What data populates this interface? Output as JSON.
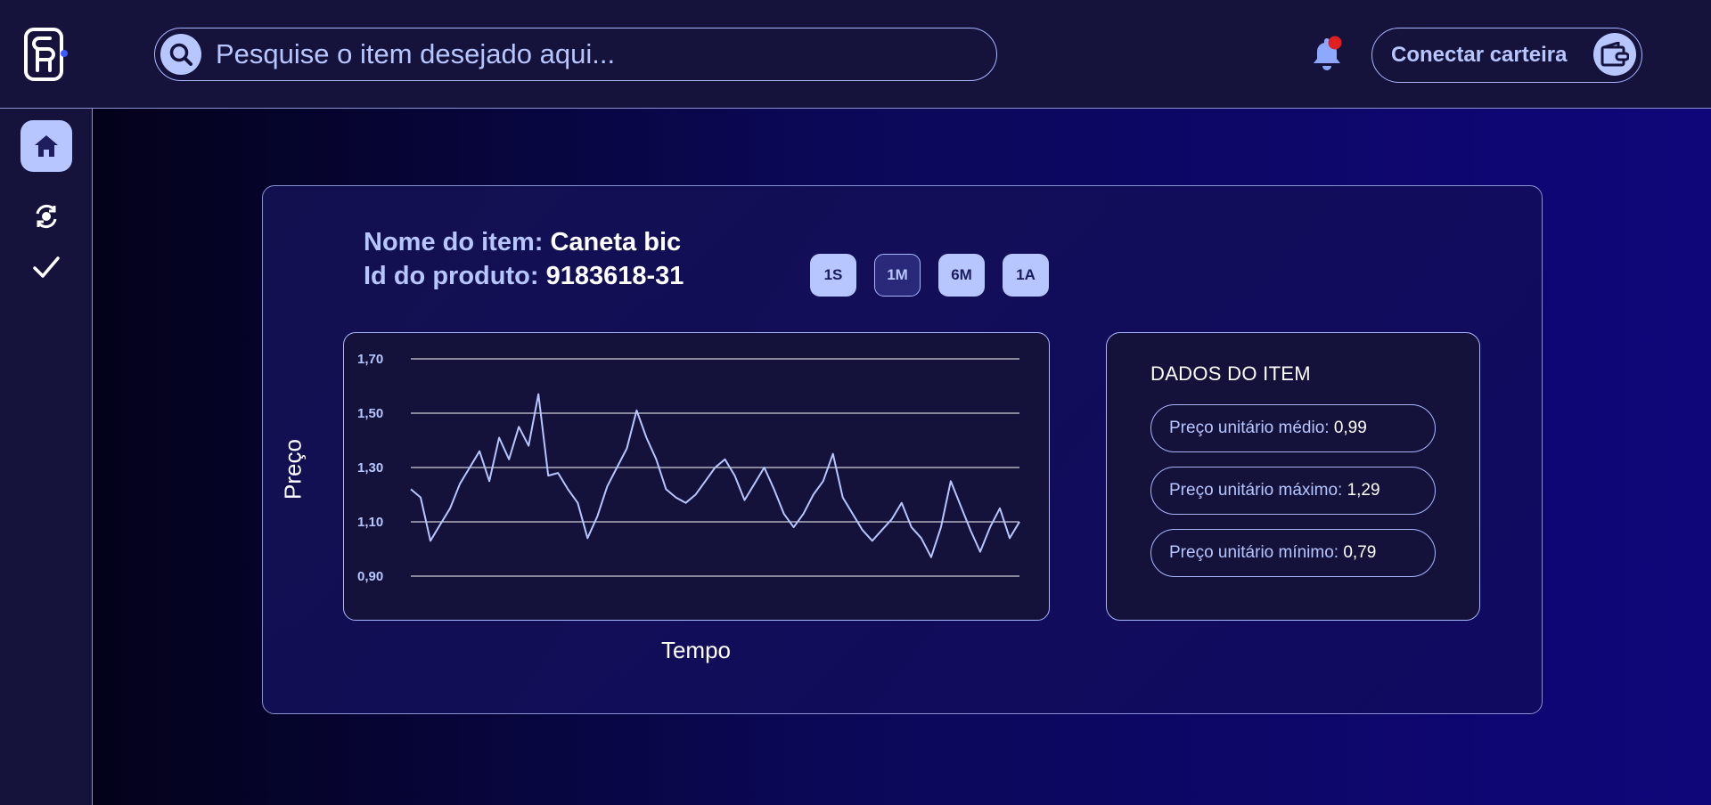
{
  "header": {
    "search_placeholder": "Pesquise o item desejado aqui...",
    "wallet_button_label": "Conectar carteira",
    "notification_badge_color": "#e02020"
  },
  "sidebar": {
    "items": [
      {
        "name": "home",
        "icon": "home-icon",
        "active": true
      },
      {
        "name": "exchange",
        "icon": "refresh-coin-icon",
        "active": false
      },
      {
        "name": "check",
        "icon": "check-icon",
        "active": false
      }
    ]
  },
  "item": {
    "name_label": "Nome do item:",
    "name_value": "Caneta bic",
    "id_label": "Id do produto:",
    "id_value": "9183618-31"
  },
  "periods": [
    {
      "label": "1S",
      "active": false
    },
    {
      "label": "1M",
      "active": true
    },
    {
      "label": "6M",
      "active": false
    },
    {
      "label": "1A",
      "active": false
    }
  ],
  "chart_data": {
    "type": "line",
    "ylabel": "Preço",
    "xlabel": "Tempo",
    "ylim": [
      0.9,
      1.7
    ],
    "yticks": [
      "1,70",
      "1,50",
      "1,30",
      "1,10",
      "0,90"
    ],
    "yticks_values": [
      1.7,
      1.5,
      1.3,
      1.1,
      0.9
    ],
    "grid": true,
    "line_color": "#b7c6ff",
    "values": [
      1.22,
      1.19,
      1.03,
      1.09,
      1.15,
      1.24,
      1.3,
      1.36,
      1.25,
      1.41,
      1.33,
      1.45,
      1.38,
      1.57,
      1.27,
      1.28,
      1.22,
      1.17,
      1.04,
      1.12,
      1.23,
      1.3,
      1.37,
      1.51,
      1.41,
      1.33,
      1.22,
      1.19,
      1.17,
      1.2,
      1.25,
      1.3,
      1.33,
      1.27,
      1.18,
      1.24,
      1.3,
      1.22,
      1.13,
      1.08,
      1.13,
      1.2,
      1.25,
      1.35,
      1.19,
      1.13,
      1.07,
      1.03,
      1.07,
      1.11,
      1.17,
      1.08,
      1.04,
      0.97,
      1.08,
      1.25,
      1.16,
      1.07,
      0.99,
      1.08,
      1.15,
      1.04,
      1.1
    ]
  },
  "item_data": {
    "title": "DADOS DO ITEM",
    "rows": [
      {
        "label": "Preço unitário médio:",
        "value": "0,99"
      },
      {
        "label": "Preço unitário máximo:",
        "value": "1,29"
      },
      {
        "label": "Preço unitário mínimo:",
        "value": "0,79"
      }
    ]
  }
}
